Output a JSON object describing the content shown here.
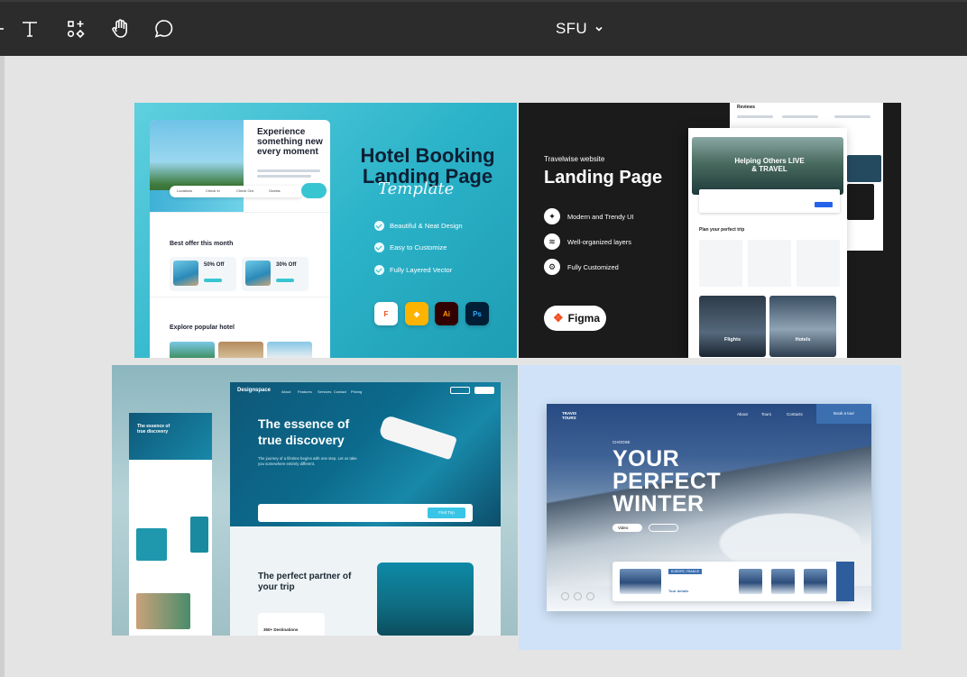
{
  "toolbar": {
    "tools": [
      {
        "name": "text-tool",
        "icon": "text-icon"
      },
      {
        "name": "resources-tool",
        "icon": "shapes-icon"
      },
      {
        "name": "hand-tool",
        "icon": "hand-icon"
      },
      {
        "name": "comment-tool",
        "icon": "comment-icon"
      }
    ],
    "file_name": "SFU"
  },
  "frame1": {
    "card_heading": "Experience something new every moment",
    "offer_title": "Best offer this month",
    "offers": [
      "50% Off",
      "30% Off"
    ],
    "explore_title": "Explore popular hotel",
    "heading": "Hotel Booking Landing Page",
    "script": "Template",
    "features": [
      "Beautiful & Neat Design",
      "Easy to Customize",
      "Fully Layered Vector"
    ],
    "apps": [
      "Figma",
      "Sketch",
      "Ai",
      "Ps"
    ],
    "search_fields": [
      "Locations",
      "Check In",
      "Check Out",
      "Guests"
    ]
  },
  "frame2": {
    "subtitle": "Travelwise website",
    "title": "Landing Page",
    "features": [
      "Modern and Trendy UI",
      "Well-organized layers",
      "Fully Customized"
    ],
    "figma_label": "Figma",
    "hero_text": "Helping Others LIVE & TRAVEL",
    "reviews_label": "Reviews",
    "plan_label": "Plan your perfect trip",
    "tiles": [
      "Flights",
      "Hotels"
    ]
  },
  "frame3": {
    "brand": "Designspace",
    "nav": [
      "About",
      "Features",
      "Services",
      "Contact",
      "Pricing"
    ],
    "hero_title": "The essence of true discovery",
    "hero_sub": "The journey of a lifetime begins with one step. Let us take you somewhere entirely different.",
    "search_button": "Find Trip",
    "partner_title": "The perfect partner of your trip",
    "destinations": "350+ Destinations",
    "mini_title": "The essence of true discovery"
  },
  "frame4": {
    "brand": "TRAVIS TOURS",
    "nav": [
      "About",
      "Tours",
      "Contacts"
    ],
    "book_button": "Book a tour",
    "choose": "CHOOSE",
    "headline": [
      "YOUR",
      "PERFECT",
      "WINTER"
    ],
    "video_label": "Video",
    "card_tag": "EUROPE, FRANCE",
    "card_link": "Tour details"
  }
}
